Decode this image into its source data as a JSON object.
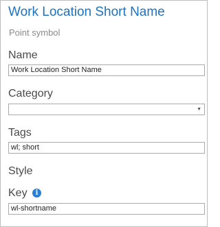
{
  "header": {
    "title": "Work Location Short Name",
    "subtitle": "Point symbol"
  },
  "name": {
    "label": "Name",
    "value": "Work Location Short Name"
  },
  "category": {
    "label": "Category",
    "value": "",
    "caret_icon": "chevron-down-icon"
  },
  "tags": {
    "label": "Tags",
    "value": "wl; short"
  },
  "style": {
    "label": "Style"
  },
  "key": {
    "label": "Key",
    "info_icon": "info-icon",
    "info_glyph": "i",
    "value": "wl-shortname"
  },
  "colors": {
    "title": "#1a73c4",
    "info": "#2b7fd4"
  }
}
